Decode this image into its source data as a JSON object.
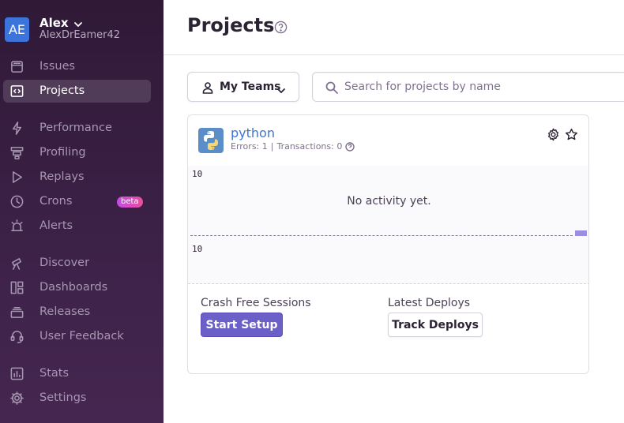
{
  "org": {
    "avatar_initials": "AE",
    "name": "Alex",
    "username": "AlexDrEamer42"
  },
  "sidebar": {
    "items": [
      {
        "label": "Issues",
        "icon": "issues-icon"
      },
      {
        "label": "Projects",
        "icon": "projects-icon",
        "active": true
      },
      {
        "label": "Performance",
        "icon": "performance-icon"
      },
      {
        "label": "Profiling",
        "icon": "profiling-icon"
      },
      {
        "label": "Replays",
        "icon": "replays-icon"
      },
      {
        "label": "Crons",
        "icon": "crons-icon",
        "badge": "beta"
      },
      {
        "label": "Alerts",
        "icon": "alerts-icon"
      },
      {
        "label": "Discover",
        "icon": "discover-icon"
      },
      {
        "label": "Dashboards",
        "icon": "dashboards-icon"
      },
      {
        "label": "Releases",
        "icon": "releases-icon"
      },
      {
        "label": "User Feedback",
        "icon": "user-feedback-icon"
      },
      {
        "label": "Stats",
        "icon": "stats-icon"
      },
      {
        "label": "Settings",
        "icon": "settings-icon"
      }
    ]
  },
  "header": {
    "title": "Projects"
  },
  "filters": {
    "teams_label": "My Teams",
    "search_placeholder": "Search for projects by name"
  },
  "project": {
    "name": "python",
    "errors_text": "Errors: 1",
    "transactions_text": "Transactions: 0",
    "chart": {
      "y_top_label": "10",
      "y_bottom_label": "10",
      "empty_text": "No activity yet."
    },
    "crash_free_label": "Crash Free Sessions",
    "start_setup_label": "Start Setup",
    "latest_deploys_label": "Latest Deploys",
    "track_deploys_label": "Track Deploys"
  },
  "colors": {
    "sidebar_bg": "#2f1937",
    "accent": "#6c5fc7",
    "link": "#3d74db",
    "avatar": "#3d74db"
  }
}
